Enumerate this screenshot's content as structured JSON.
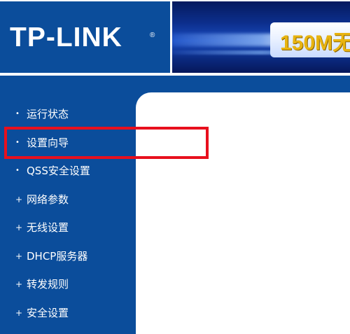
{
  "header": {
    "logo_text": "TP-LINK",
    "logo_reg": "®",
    "banner_text": "150M无"
  },
  "sidebar": {
    "items": [
      {
        "label": "运行状态",
        "bullet": "•"
      },
      {
        "label": "设置向导",
        "bullet": "•"
      },
      {
        "label": "QSS安全设置",
        "bullet": "•"
      },
      {
        "label": "网络参数",
        "bullet": "+"
      },
      {
        "label": "无线设置",
        "bullet": "+"
      },
      {
        "label": "DHCP服务器",
        "bullet": "+"
      },
      {
        "label": "转发规则",
        "bullet": "+"
      },
      {
        "label": "安全设置",
        "bullet": "+"
      }
    ]
  },
  "colors": {
    "brand_blue": "#0b4d9b",
    "highlight_red": "#e8101d",
    "banner_gold": "#e8b412"
  }
}
